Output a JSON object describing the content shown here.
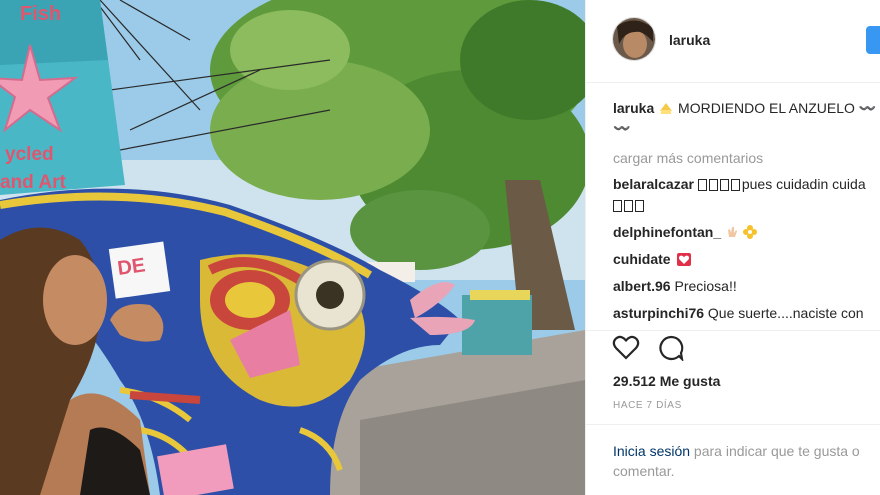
{
  "post": {
    "username": "laruka",
    "caption_user": "laruka",
    "caption_text": "MORDIENDO EL ANZUELO 〰️",
    "caption_line2": "〰️",
    "load_more": "cargar más comentarios"
  },
  "comments": [
    {
      "user": "belaralcazar",
      "text": "pues cuidadin cuida",
      "line2_boxes": 3
    },
    {
      "user": "delphinefontan_",
      "text": ""
    },
    {
      "user": "cuhidate",
      "text": ""
    },
    {
      "user": "albert.96",
      "text": "Preciosa!!"
    },
    {
      "user": "asturpinchi76",
      "text": "Que suerte....naciste con"
    }
  ],
  "likes": "29.512 Me gusta",
  "time": "HACE 7 DÍAS",
  "login": {
    "link": "Inicia sesión",
    "text": " para indicar que te gusta o comentar."
  },
  "photo_sign": {
    "line1": "Fish",
    "line2": "ycled",
    "line3": "and Art",
    "sign2": "DE"
  },
  "colors": {
    "accent": "#3897f0",
    "link": "#003569",
    "muted": "#999999",
    "heart_red": "#ed4956"
  },
  "icons": [
    "heart-icon",
    "comment-icon",
    "follow-button"
  ]
}
